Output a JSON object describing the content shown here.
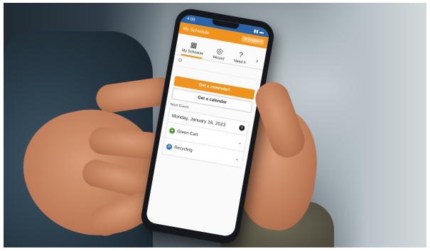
{
  "status": {
    "time": "4:09"
  },
  "app": {
    "title": "My Schedule",
    "language": "English"
  },
  "tabs": [
    {
      "label": "My Schedule",
      "icon": "calendar-icon",
      "glyph": "▦"
    },
    {
      "label": "Wizard",
      "icon": "search-icon",
      "glyph": "◎"
    },
    {
      "label": "Need h",
      "icon": "help-icon",
      "glyph": "?"
    }
  ],
  "address_glyph": "⊙",
  "buttons": {
    "reminder": "Get a reminder!",
    "calendar": "Get a calendar"
  },
  "next_event": {
    "label": "Next Event",
    "date": "Monday, January 16, 2023"
  },
  "events": [
    {
      "label": "Green Cart",
      "icon": "green-cart-icon",
      "color": "#4a9b2f"
    },
    {
      "label": "Recycling",
      "icon": "recycling-icon",
      "color": "#2b6cc4"
    }
  ],
  "colors": {
    "accent": "#f0921e",
    "statusbar": "#2a63a8"
  }
}
